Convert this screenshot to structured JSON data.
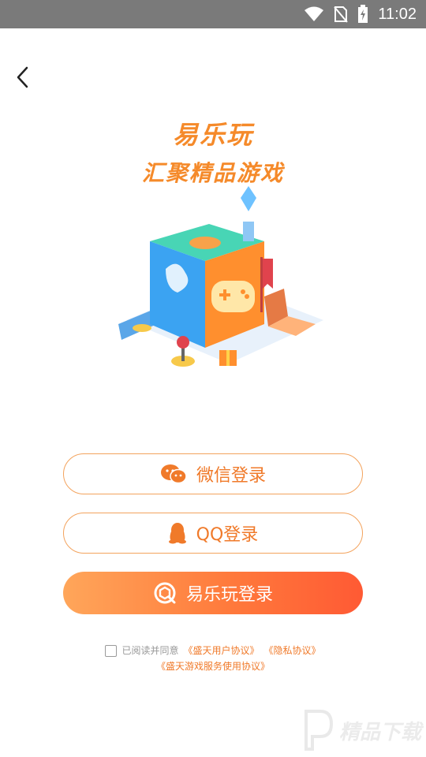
{
  "status_bar": {
    "time": "11:02",
    "icons": [
      "wifi-icon",
      "no-sim-icon",
      "battery-charging-icon"
    ]
  },
  "header": {
    "back_icon": "chevron-left-icon"
  },
  "hero": {
    "brand": "易乐玩",
    "slogan": "汇聚精品游戏"
  },
  "login": {
    "wechat_label": "微信登录",
    "qq_label": "QQ登录",
    "main_label": "易乐玩登录"
  },
  "agreement": {
    "prefix": "已阅读并同意",
    "user_agreement": "《盛天用户协议》",
    "privacy": "《隐私协议》",
    "service": "《盛天游戏服务使用协议》"
  },
  "watermark": {
    "text": "精品下载"
  },
  "colors": {
    "accent": "#f07a2a",
    "gradient_start": "#ffa65a",
    "gradient_end": "#ff5a34"
  }
}
